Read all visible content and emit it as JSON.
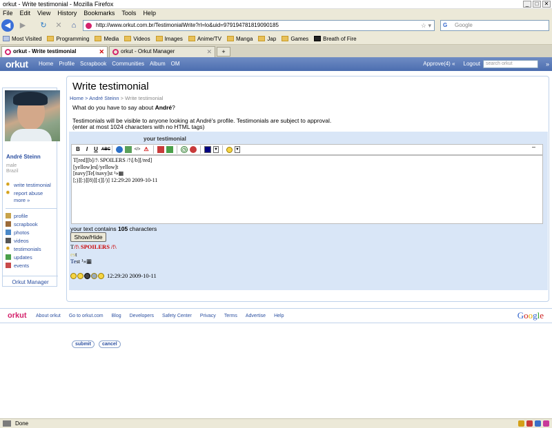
{
  "window": {
    "title": "orkut - Write testimonial - Mozilla Firefox",
    "controls": [
      "_",
      "□",
      "✕"
    ]
  },
  "menu": [
    "File",
    "Edit",
    "View",
    "History",
    "Bookmarks",
    "Tools",
    "Help"
  ],
  "nav": {
    "url": "http://www.orkut.com.br/TestimonialWrite?rl=lo&uid=979194781819090185",
    "search_placeholder": "Google"
  },
  "bookmarks": [
    "Most Visited",
    "Programming",
    "Media",
    "Videos",
    "Images",
    "Anime/TV",
    "Manga",
    "Jap",
    "Games",
    "Breath of Fire"
  ],
  "tabs": [
    {
      "label": "orkut - Write testimonial",
      "active": true
    },
    {
      "label": "orkut - Orkut Manager",
      "active": false
    }
  ],
  "orkut_header": {
    "logo": "orkut",
    "nav": [
      "Home",
      "Profile",
      "Scrapbook",
      "Communities",
      "Album",
      "OM"
    ],
    "approve": "Approve(4)",
    "approve_arrow": "«",
    "logout": "Logout",
    "search_placeholder": "search orkut",
    "search_btn": "»"
  },
  "sidebar": {
    "name": "André Steinn",
    "gender": "male",
    "country": "Brazil",
    "actions": [
      {
        "label": "write testimonial",
        "icon": "gear-icon"
      },
      {
        "label": "report abuse",
        "icon": "gear-icon"
      }
    ],
    "more": "more »",
    "links": [
      {
        "label": "profile",
        "icon": "profile-icon"
      },
      {
        "label": "scrapbook",
        "icon": "scrapbook-icon"
      },
      {
        "label": "photos",
        "icon": "photos-icon"
      },
      {
        "label": "videos",
        "icon": "videos-icon"
      },
      {
        "label": "testimonials",
        "icon": "testimonials-icon"
      },
      {
        "label": "updates",
        "icon": "updates-icon"
      },
      {
        "label": "events",
        "icon": "events-icon"
      }
    ],
    "manager": "Orkut Manager"
  },
  "main": {
    "title": "Write testimonial",
    "breadcrumb": {
      "home": "Home",
      "sep1": " > ",
      "user": "André Steinn",
      "sep2": " > ",
      "current": "Write testimonial"
    },
    "question_prefix": "What do you have to say about ",
    "question_name": "André",
    "question_suffix": "?",
    "notice1": "Testimonials will be visible to anyone looking at André's profile. Testimonials are subject to approval.",
    "notice2": "(enter at most 1024 characters with no HTML tags)",
    "form_label": "your testimonial",
    "collapse": "–",
    "textarea_lines": [
      "T[red][b]/!\\ SPOILERS /!\\[/b][/red]",
      "[yellow]es[/yellow]t",
      "[navy]Te[/navy]st ¹»▦",
      "",
      "[;)][:)][8)][:(][/)]      12:29:20 2009-10-11"
    ],
    "charcount_prefix": "your text contains ",
    "charcount_num": "105",
    "charcount_suffix": " characters",
    "showhide": "Show/Hide",
    "preview": {
      "line1_t": "T",
      "line1_red": "/!\\ SPOILERS /!\\",
      "line2_yel": "es",
      "line2_t": "t",
      "line3_navy": "Te",
      "line3_rest": "st ¹»▦",
      "line4_time": "12:29:20 2009-10-11"
    },
    "submit": "submit",
    "cancel": "cancel"
  },
  "footer": {
    "logo": "orkut",
    "links": [
      "About orkut",
      "Go to orkut.com",
      "Blog",
      "Developers",
      "Safety Center",
      "Privacy",
      "Terms",
      "Advertise",
      "Help"
    ]
  },
  "status": {
    "text": "Done"
  },
  "colors": {
    "orkut_blue": "#4c6eb0",
    "orkut_pink": "#d4236c",
    "link": "#2b4fa0",
    "panel": "#d9e6f7"
  }
}
